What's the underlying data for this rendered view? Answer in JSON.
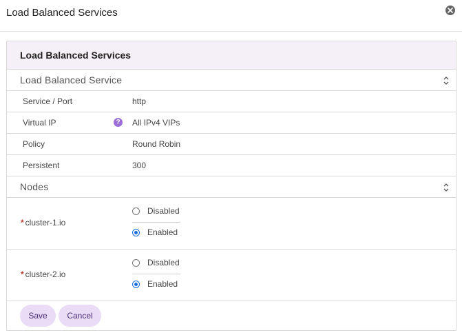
{
  "dialog": {
    "title": "Load Balanced Services",
    "close_icon": "close-icon"
  },
  "panel": {
    "title": "Load Balanced Services"
  },
  "service_section": {
    "title": "Load Balanced Service",
    "rows": [
      {
        "label": "Service / Port",
        "value": "http"
      },
      {
        "label": "Virtual IP",
        "value": "All IPv4 VIPs",
        "help_icon": "help-icon"
      },
      {
        "label": "Policy",
        "value": "Round Robin"
      },
      {
        "label": "Persistent",
        "value": "300"
      }
    ]
  },
  "nodes_section": {
    "title": "Nodes",
    "nodes": [
      {
        "name": "cluster-1.io",
        "required": "*",
        "options": [
          "Disabled",
          "Enabled"
        ],
        "selected": "Enabled"
      },
      {
        "name": "cluster-2.io",
        "required": "*",
        "options": [
          "Disabled",
          "Enabled"
        ],
        "selected": "Enabled"
      }
    ]
  },
  "actions": {
    "save_label": "Save",
    "cancel_label": "Cancel"
  },
  "colors": {
    "accent": "#1a6fd8",
    "panel_header_bg": "#f5eff7",
    "button_bg": "#eadcf7",
    "help_icon": "#9b6fd6",
    "required": "#c0392b"
  }
}
